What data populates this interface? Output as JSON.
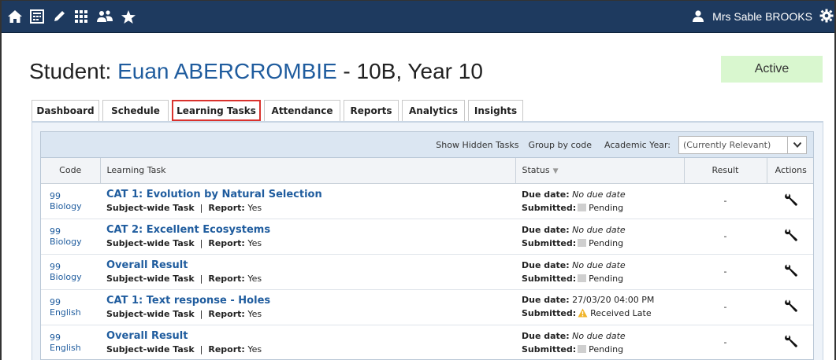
{
  "topbar": {
    "icons": [
      "home-icon",
      "calendar-icon",
      "pencil-icon",
      "grid-icon",
      "people-icon",
      "star-icon"
    ],
    "user_name": "Mrs Sable BROOKS",
    "user_icon": "user-icon",
    "settings_icon": "gear-icon"
  },
  "student": {
    "prefix": "Student: ",
    "name": "Euan ABERCROMBIE",
    "suffix": " - 10B, Year 10",
    "status": "Active"
  },
  "tabs": [
    "Dashboard",
    "Schedule",
    "Learning Tasks",
    "Attendance",
    "Reports",
    "Analytics",
    "Insights"
  ],
  "active_tab": "Learning Tasks",
  "toolbar": {
    "show_hidden": "Show Hidden Tasks",
    "group_by": "Group by code",
    "year_label": "Academic Year:",
    "year_value": "(Currently Relevant)"
  },
  "columns": {
    "code": "Code",
    "task": "Learning Task",
    "status": "Status",
    "result": "Result",
    "actions": "Actions"
  },
  "rows": [
    {
      "code": "99 Biology",
      "title": "CAT 1: Evolution by Natural Selection",
      "type": "Subject-wide Task",
      "report_label": "Report:",
      "report": "Yes",
      "due_label": "Due date:",
      "due": "No due date",
      "submitted_label": "Submitted:",
      "submitted": "Pending",
      "result": "-"
    },
    {
      "code": "99 Biology",
      "title": "CAT 2: Excellent Ecosystems",
      "type": "Subject-wide Task",
      "report_label": "Report:",
      "report": "Yes",
      "due_label": "Due date:",
      "due": "No due date",
      "submitted_label": "Submitted:",
      "submitted": "Pending",
      "result": "-"
    },
    {
      "code": "99 Biology",
      "title": "Overall Result",
      "type": "Subject-wide Task",
      "report_label": "Report:",
      "report": "Yes",
      "due_label": "Due date:",
      "due": "No due date",
      "submitted_label": "Submitted:",
      "submitted": "Pending",
      "result": "-"
    },
    {
      "code": "99 English",
      "title": "CAT 1: Text response - Holes",
      "type": "Subject-wide Task",
      "report_label": "Report:",
      "report": "Yes",
      "due_label": "Due date:",
      "due": "27/03/20 04:00 PM",
      "submitted_label": "Submitted:",
      "submitted": "Received Late",
      "result": "-"
    },
    {
      "code": "99 English",
      "title": "Overall Result",
      "type": "Subject-wide Task",
      "report_label": "Report:",
      "report": "Yes",
      "due_label": "Due date:",
      "due": "No due date",
      "submitted_label": "Submitted:",
      "submitted": "Pending",
      "result": "-"
    }
  ],
  "colors": {
    "topbar": "#1e3a5f",
    "link": "#1f5c9e",
    "active_badge": "#d9f7cf",
    "active_tab_border": "#d9322d",
    "late_warning": "#f0b429"
  }
}
